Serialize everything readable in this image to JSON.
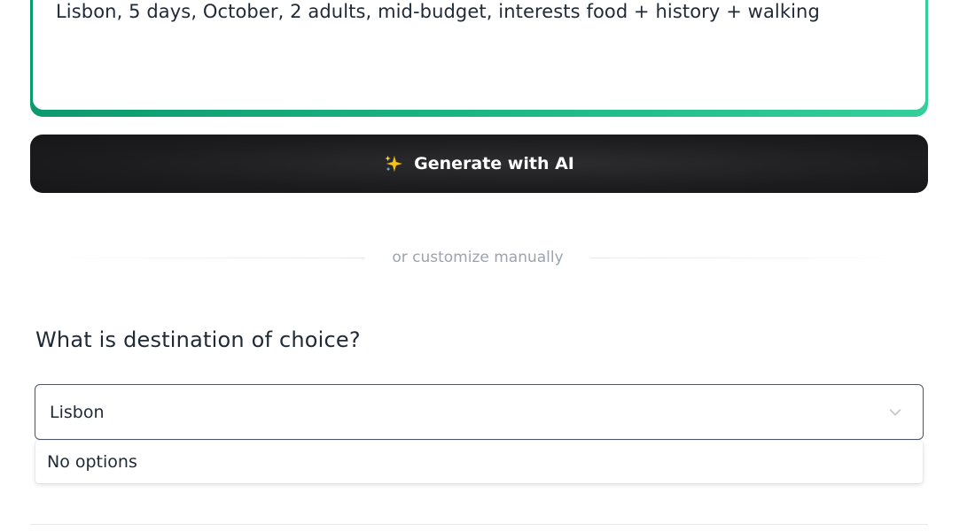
{
  "prompt": {
    "text": "Lisbon, 5 days, October, 2 adults, mid-budget, interests food + history + walking"
  },
  "generate_button": {
    "label": "Generate with AI",
    "icon": "sparkle-icon"
  },
  "divider": {
    "label": "or customize manually"
  },
  "destination": {
    "question": "What is destination of choice?",
    "input_value": "Lisbon",
    "dropdown_icon": "chevron-down-icon",
    "dropdown_message": "No options"
  },
  "colors": {
    "accent_green": "#1db584",
    "button_dark": "#1c1c1e",
    "muted_text": "#9ca3af"
  }
}
